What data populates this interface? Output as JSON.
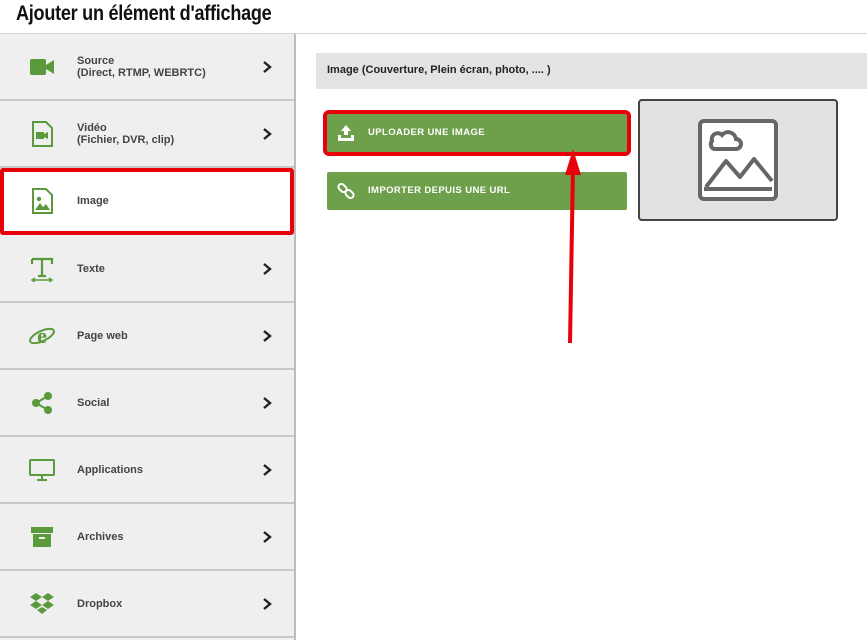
{
  "header": {
    "title": "Ajouter un élément d'affichage"
  },
  "sidebar": {
    "items": [
      {
        "line1": "Source",
        "line2": "(Direct, RTMP, WEBRTC)",
        "icon": "video-camera-icon"
      },
      {
        "line1": "Vidéo",
        "line2": "(Fichier, DVR, clip)",
        "icon": "video-file-icon"
      },
      {
        "line1": "Image",
        "line2": "",
        "icon": "image-file-icon"
      },
      {
        "line1": "Texte",
        "line2": "",
        "icon": "text-icon"
      },
      {
        "line1": "Page web",
        "line2": "",
        "icon": "web-browser-icon"
      },
      {
        "line1": "Social",
        "line2": "",
        "icon": "share-icon"
      },
      {
        "line1": "Applications",
        "line2": "",
        "icon": "monitor-icon"
      },
      {
        "line1": "Archives",
        "line2": "",
        "icon": "archive-box-icon"
      },
      {
        "line1": "Dropbox",
        "line2": "",
        "icon": "dropbox-icon"
      }
    ],
    "active_index": 2
  },
  "content": {
    "section_title": "Image (Couverture, Plein écran, photo, .... )",
    "upload_button": "UPLOADER UNE IMAGE",
    "url_button": "IMPORTER DEPUIS UNE URL",
    "preview_icon": "image-placeholder-icon"
  },
  "colors": {
    "accent_green": "#6ea04b",
    "highlight_red": "#e8000b",
    "icon_green": "#5a9a3c"
  }
}
